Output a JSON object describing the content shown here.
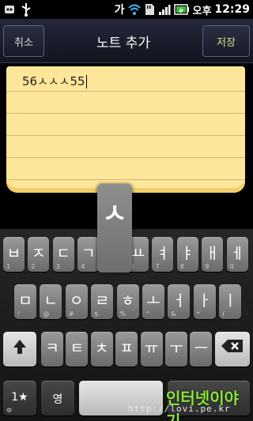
{
  "status_bar": {
    "ime_label": "가",
    "ampm": "오후",
    "time": "12:29"
  },
  "title_bar": {
    "cancel_label": "취소",
    "title": "노트 추가",
    "save_label": "저장"
  },
  "note": {
    "text": "56ㅅㅅㅅ55"
  },
  "popup": {
    "char": "ㅅ"
  },
  "keyboard": {
    "row1": [
      {
        "main": "ㅂ",
        "sub": "1"
      },
      {
        "main": "ㅈ",
        "sub": "2"
      },
      {
        "main": "ㄷ",
        "sub": "3"
      },
      {
        "main": "ㄱ",
        "sub": "4"
      },
      {
        "main": "ㅅ",
        "sub": "5"
      },
      {
        "main": "ㅛ",
        "sub": "6"
      },
      {
        "main": "ㅕ",
        "sub": "7"
      },
      {
        "main": "ㅑ",
        "sub": "8"
      },
      {
        "main": "ㅐ",
        "sub": "9"
      },
      {
        "main": "ㅔ",
        "sub": "0"
      }
    ],
    "row2": [
      {
        "main": "ㅁ",
        "sub": "!"
      },
      {
        "main": "ㄴ",
        "sub": "@"
      },
      {
        "main": "ㅇ",
        "sub": "#"
      },
      {
        "main": "ㄹ",
        "sub": "$"
      },
      {
        "main": "ㅎ",
        "sub": "%"
      },
      {
        "main": "ㅗ",
        "sub": "^"
      },
      {
        "main": "ㅓ",
        "sub": "&"
      },
      {
        "main": "ㅏ",
        "sub": "*"
      },
      {
        "main": "ㅣ",
        "sub": "("
      }
    ],
    "row3": [
      {
        "main": "ㅋ",
        "sub": ""
      },
      {
        "main": "ㅌ",
        "sub": ""
      },
      {
        "main": "ㅊ",
        "sub": ""
      },
      {
        "main": "ㅍ",
        "sub": ""
      },
      {
        "main": "ㅠ",
        "sub": ""
      },
      {
        "main": "ㅜ",
        "sub": ""
      },
      {
        "main": "ㅡ",
        "sub": ""
      }
    ],
    "sym_label": "1★",
    "lang_label": "영"
  },
  "watermark": {
    "title": "인터넷이야기",
    "url": "http://lovi.pe.kr"
  }
}
